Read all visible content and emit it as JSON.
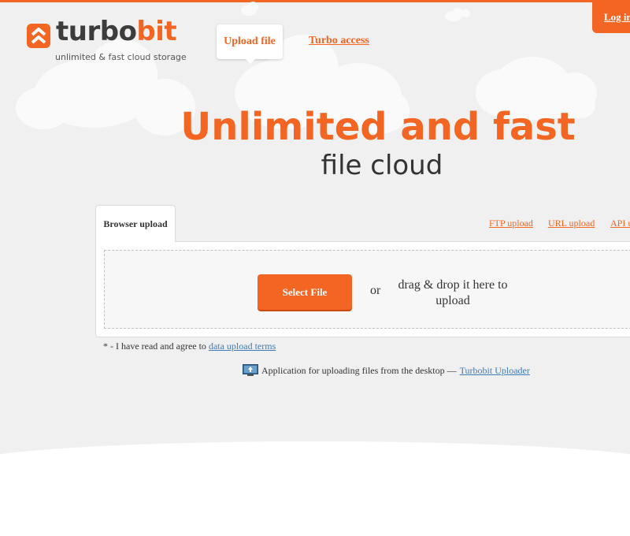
{
  "brand": {
    "name_part1": "turbo",
    "name_part2": "bit",
    "tagline": "unlimited & fast cloud storage",
    "accent_color": "#f26522"
  },
  "nav": {
    "upload_label": "Upload file",
    "turbo_access_label": "Turbo access",
    "login_label": "Log in"
  },
  "hero": {
    "title": "Unlimited and fast",
    "subtitle": "file cloud"
  },
  "upload": {
    "tabs": {
      "browser": "Browser upload",
      "ftp": "FTP upload",
      "url": "URL upload",
      "api": "API upload"
    },
    "select_button": "Select File",
    "or_text": "or",
    "drag_text": "drag & drop it here to upload"
  },
  "terms": {
    "prefix": "* - I have read and agree to",
    "link": "data upload terms"
  },
  "desktop_app": {
    "icon": "download-monitor-icon",
    "text": "Application for uploading files from the desktop —",
    "link": "Turbobit Uploader"
  }
}
